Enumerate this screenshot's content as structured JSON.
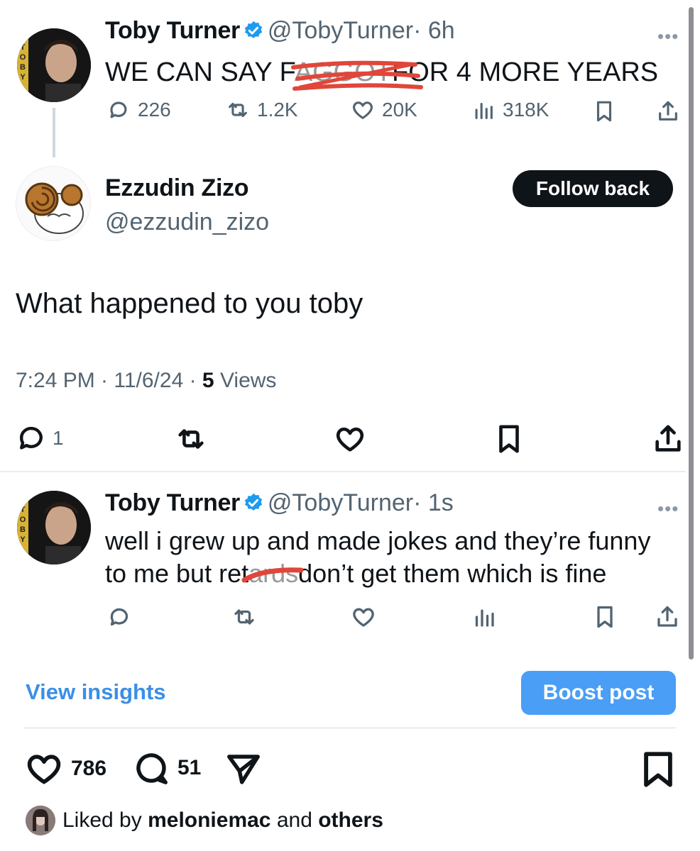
{
  "tweet1": {
    "name": "Toby Turner",
    "handle": "@TobyTurner",
    "time": "· 6h",
    "text_before": "WE CAN SAY F",
    "text_redacted": "AGGOT",
    "text_after": "FOR 4 MORE YEARS",
    "stats": {
      "replies": "226",
      "retweets": "1.2K",
      "likes": "20K",
      "views": "318K"
    }
  },
  "reply": {
    "name": "Ezzudin Zizo",
    "handle": "@ezzudin_zizo",
    "follow_label": "Follow back",
    "text": "What happened to you toby",
    "time": "7:24 PM · 11/6/24 · ",
    "views_count": "5",
    "views_label": " Views",
    "reply_count": "1"
  },
  "tweet2": {
    "name": "Toby Turner",
    "handle": "@TobyTurner",
    "time": "· 1s",
    "line1": "well i grew up and made jokes and they’re funny",
    "line2_before": "to me but ret",
    "line2_redacted": "ards",
    "line2_after": "don’t get them which is fine"
  },
  "actions": {
    "insights": "View insights",
    "boost": "Boost post"
  },
  "instagram": {
    "likes": "786",
    "comments": "51",
    "liked_by_prefix": "Liked by ",
    "liked_by_user": "meloniemac",
    "liked_by_mid": " and ",
    "liked_by_others": "others"
  },
  "colors": {
    "verified": "#1d9bf0",
    "redaction": "#e0463a",
    "link": "#3b8fe6",
    "boost": "#4a9ef5"
  }
}
